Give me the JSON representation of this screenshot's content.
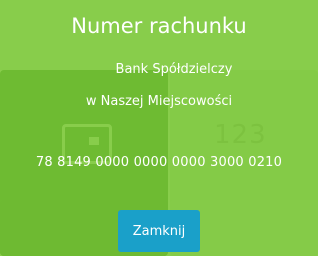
{
  "modal": {
    "title": "Numer rachunku",
    "bank_name_line1": "Bank Spółdzielczy",
    "bank_name_line2": "w Naszej Miejscowości",
    "account_number": "78 8149 0000 0000 0000 3000 0210",
    "close_label": "Zamknij"
  },
  "background": {
    "digits": "123"
  },
  "colors": {
    "overlay": "#78c632",
    "button": "#1aa0c9",
    "text": "#ffffff"
  }
}
